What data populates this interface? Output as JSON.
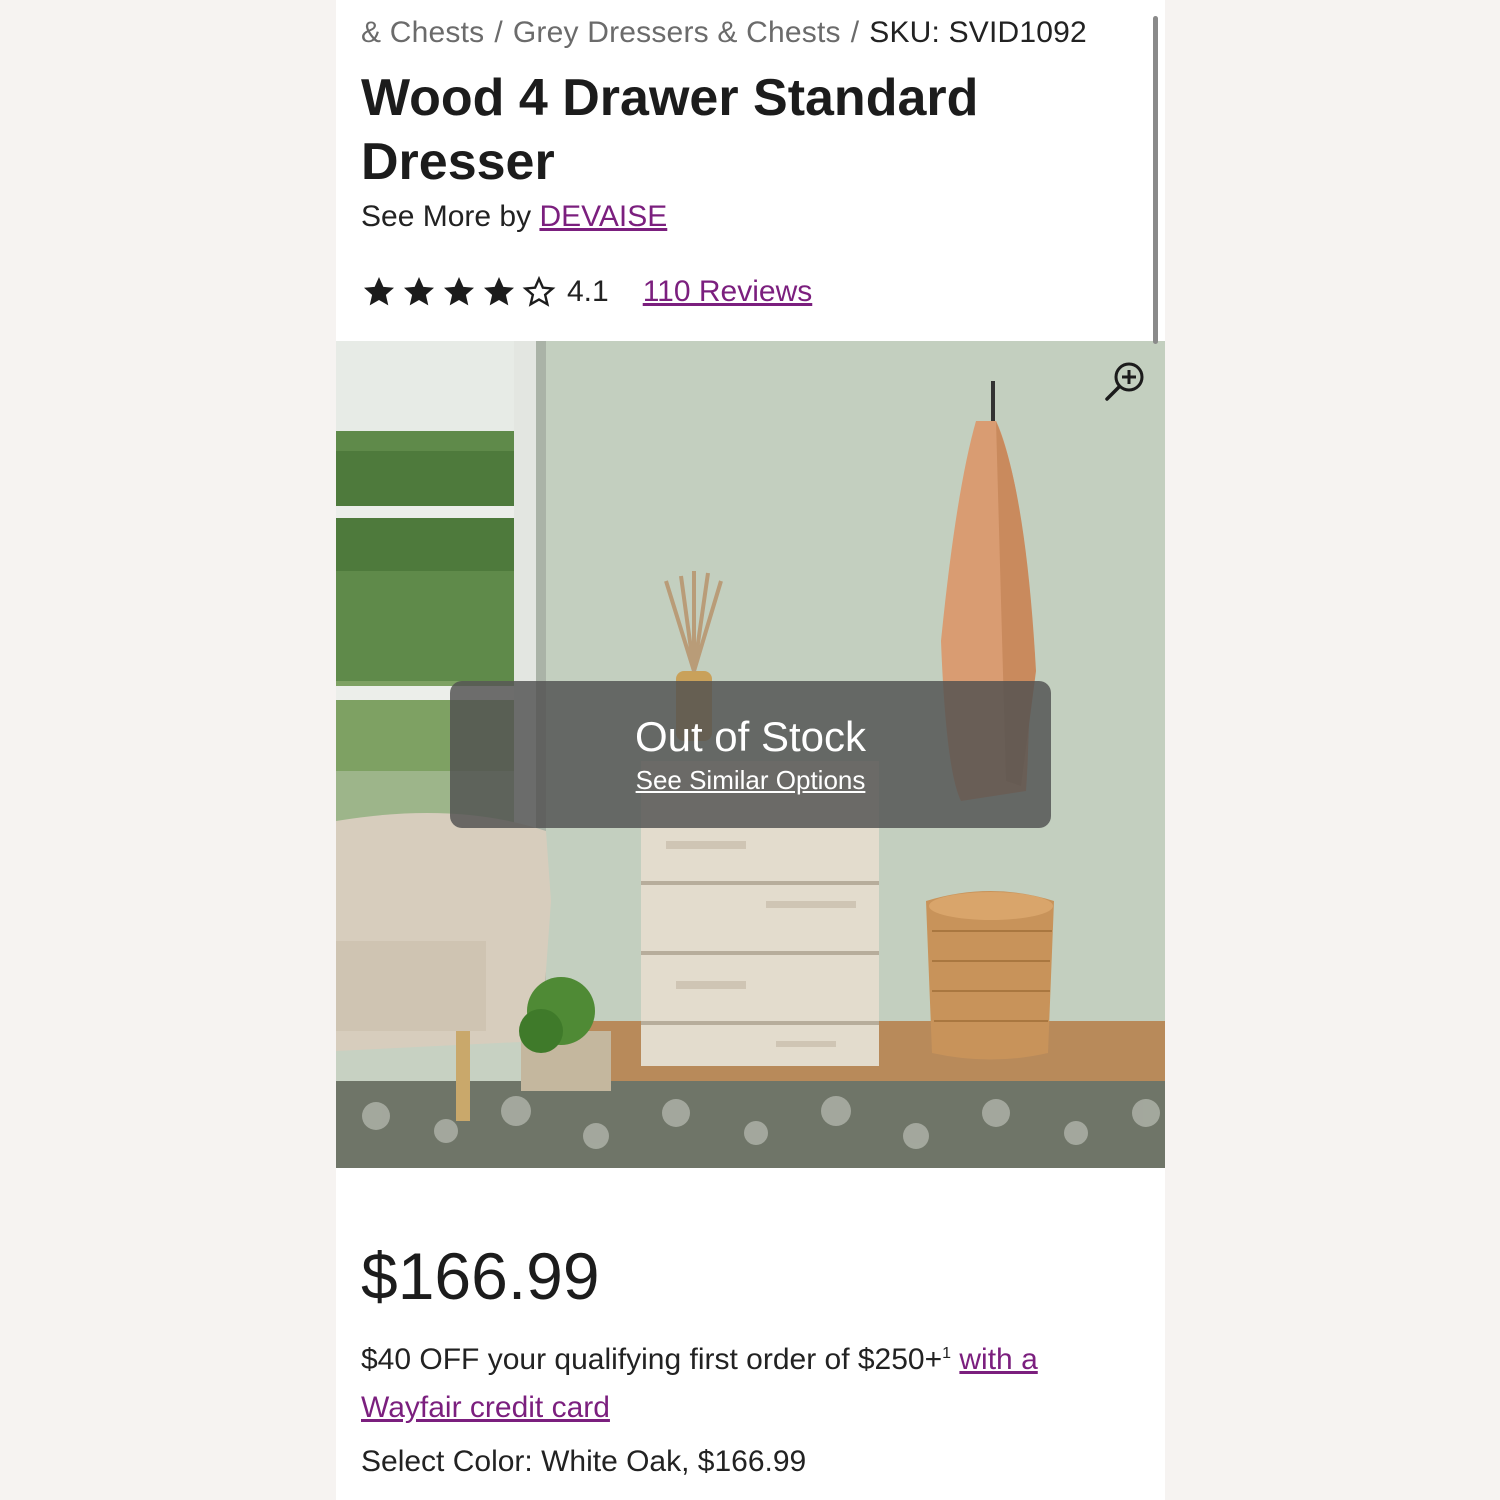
{
  "breadcrumb": {
    "items": [
      "& Chests",
      "Grey Dressers & Chests"
    ],
    "sku": "SKU: SVID1092"
  },
  "product": {
    "title": "Wood 4 Drawer Standard Dresser",
    "see_more_prefix": "See More by",
    "brand": "DEVAISE",
    "rating": 4.1,
    "rating_text": "4.1",
    "stars_filled": 4,
    "stars_total": 5,
    "reviews_label": "110 Reviews"
  },
  "gallery": {
    "zoom_icon": "zoom-in-icon",
    "status_title": "Out of Stock",
    "status_link": "See Similar Options"
  },
  "pricing": {
    "price": "$166.99",
    "promo_text": "$40 OFF your qualifying first order of $250+",
    "promo_sup": "1",
    "promo_link": "with a Wayfair credit card"
  },
  "options": {
    "select_color": "Select Color: White Oak, $166.99"
  },
  "colors": {
    "link": "#7b1f7e",
    "text": "#1c1c1c",
    "background": "#f6f3f1"
  }
}
